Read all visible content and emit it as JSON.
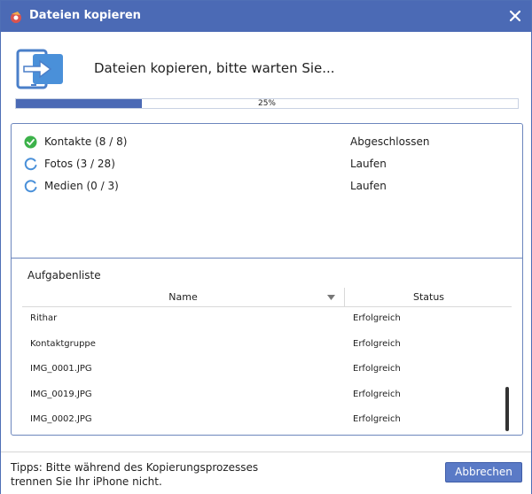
{
  "window": {
    "title": "Dateien kopieren",
    "close_icon": "close-icon"
  },
  "header": {
    "message": "Dateien kopieren, bitte warten Sie..."
  },
  "progress": {
    "percent": 25,
    "label": "25%"
  },
  "categories": [
    {
      "name": "Kontakte (8 / 8)",
      "state": "Abgeschlossen",
      "icon": "check-icon"
    },
    {
      "name": "Fotos (3 / 28)",
      "state": "Laufen",
      "icon": "spinner-icon"
    },
    {
      "name": "Medien (0 / 3)",
      "state": "Laufen",
      "icon": "spinner-icon"
    }
  ],
  "task_list": {
    "title": "Aufgabenliste",
    "columns": {
      "name": "Name",
      "status": "Status"
    },
    "rows": [
      {
        "name": "Rithar",
        "status": "Erfolgreich"
      },
      {
        "name": "Kontaktgruppe",
        "status": "Erfolgreich"
      },
      {
        "name": "IMG_0001.JPG",
        "status": "Erfolgreich"
      },
      {
        "name": "IMG_0019.JPG",
        "status": "Erfolgreich"
      },
      {
        "name": "IMG_0002.JPG",
        "status": "Erfolgreich"
      }
    ]
  },
  "footer": {
    "tips_line1": "Tipps: Bitte während des Kopierungsprozesses",
    "tips_line2": "trennen Sie Ihr iPhone nicht.",
    "cancel_label": "Abbrechen"
  },
  "colors": {
    "titlebar": "#4b6ab5",
    "accent": "#5a7ac6",
    "success": "#3cb24a",
    "spinner": "#4a90d9"
  }
}
